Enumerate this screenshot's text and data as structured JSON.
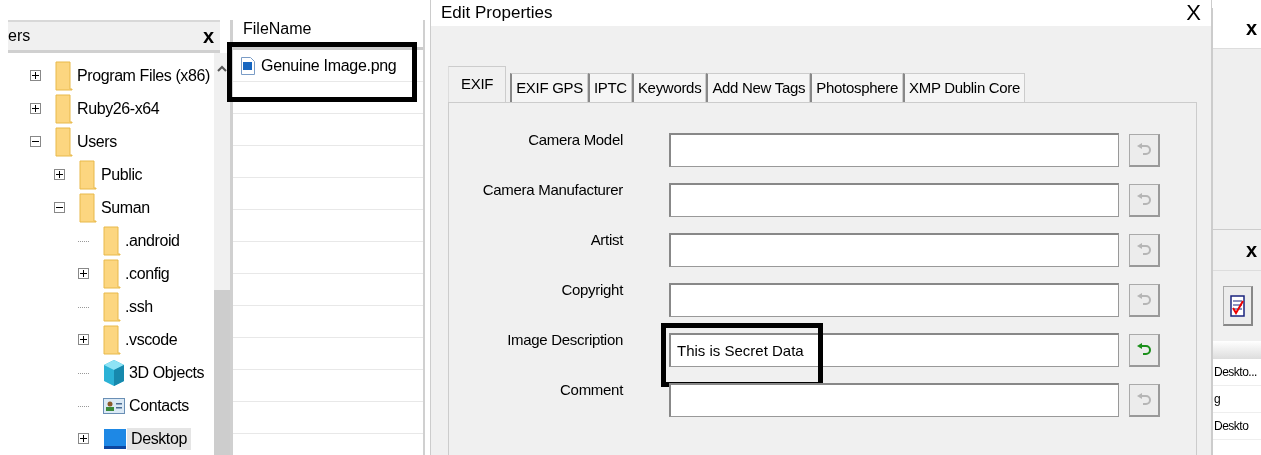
{
  "left_panel": {
    "title": "ers",
    "close": "x",
    "tree": [
      {
        "label": "Program Files (x86)",
        "kind": "folder",
        "expanded": false,
        "selected": false
      },
      {
        "label": "Ruby26-x64",
        "kind": "folder",
        "expanded": false,
        "selected": false
      },
      {
        "label": "Users",
        "kind": "folder",
        "expanded": true,
        "selected": false,
        "children": [
          {
            "label": "Public",
            "kind": "folder",
            "expanded": false,
            "selected": false
          },
          {
            "label": "Suman",
            "kind": "folder",
            "expanded": true,
            "selected": false,
            "children": [
              {
                "label": ".android",
                "kind": "folder",
                "selected": false
              },
              {
                "label": ".config",
                "kind": "folder",
                "expanded": false,
                "selected": false
              },
              {
                "label": ".ssh",
                "kind": "folder",
                "selected": false
              },
              {
                "label": ".vscode",
                "kind": "folder",
                "expanded": false,
                "selected": false
              },
              {
                "label": "3D Objects",
                "kind": "cube",
                "selected": false
              },
              {
                "label": "Contacts",
                "kind": "contacts",
                "selected": false
              },
              {
                "label": "Desktop",
                "kind": "desktop",
                "expanded": false,
                "selected": true
              }
            ]
          }
        ]
      }
    ]
  },
  "file_list": {
    "column": "FileName",
    "rows": [
      {
        "name": "Genuine Image.png",
        "highlighted": true
      }
    ]
  },
  "dialog": {
    "title": "Edit Properties",
    "close": "X",
    "tabs": [
      {
        "label": "EXIF",
        "selected": true
      },
      {
        "label": "EXIF GPS",
        "selected": false
      },
      {
        "label": "IPTC",
        "selected": false
      },
      {
        "label": "Keywords",
        "selected": false
      },
      {
        "label": "Add New Tags",
        "selected": false
      },
      {
        "label": "Photosphere",
        "selected": false
      },
      {
        "label": "XMP Dublin Core",
        "selected": false
      }
    ],
    "fields": [
      {
        "label": "Camera Model",
        "revertable": false,
        "highlighted": false
      },
      {
        "label": "Camera Manufacturer",
        "revertable": false,
        "highlighted": false
      },
      {
        "label": "Artist",
        "revertable": false,
        "highlighted": false
      },
      {
        "label": "Copyright",
        "revertable": false,
        "highlighted": false
      },
      {
        "label": "Image Description",
        "value": "This is Secret Data",
        "revertable": true,
        "highlighted": true
      },
      {
        "label": "Comment",
        "revertable": false,
        "highlighted": false
      }
    ]
  },
  "right_panel": {
    "close": "x",
    "lower_close": "x",
    "rows": [
      "Deskto...",
      "g",
      "Deskto"
    ]
  }
}
